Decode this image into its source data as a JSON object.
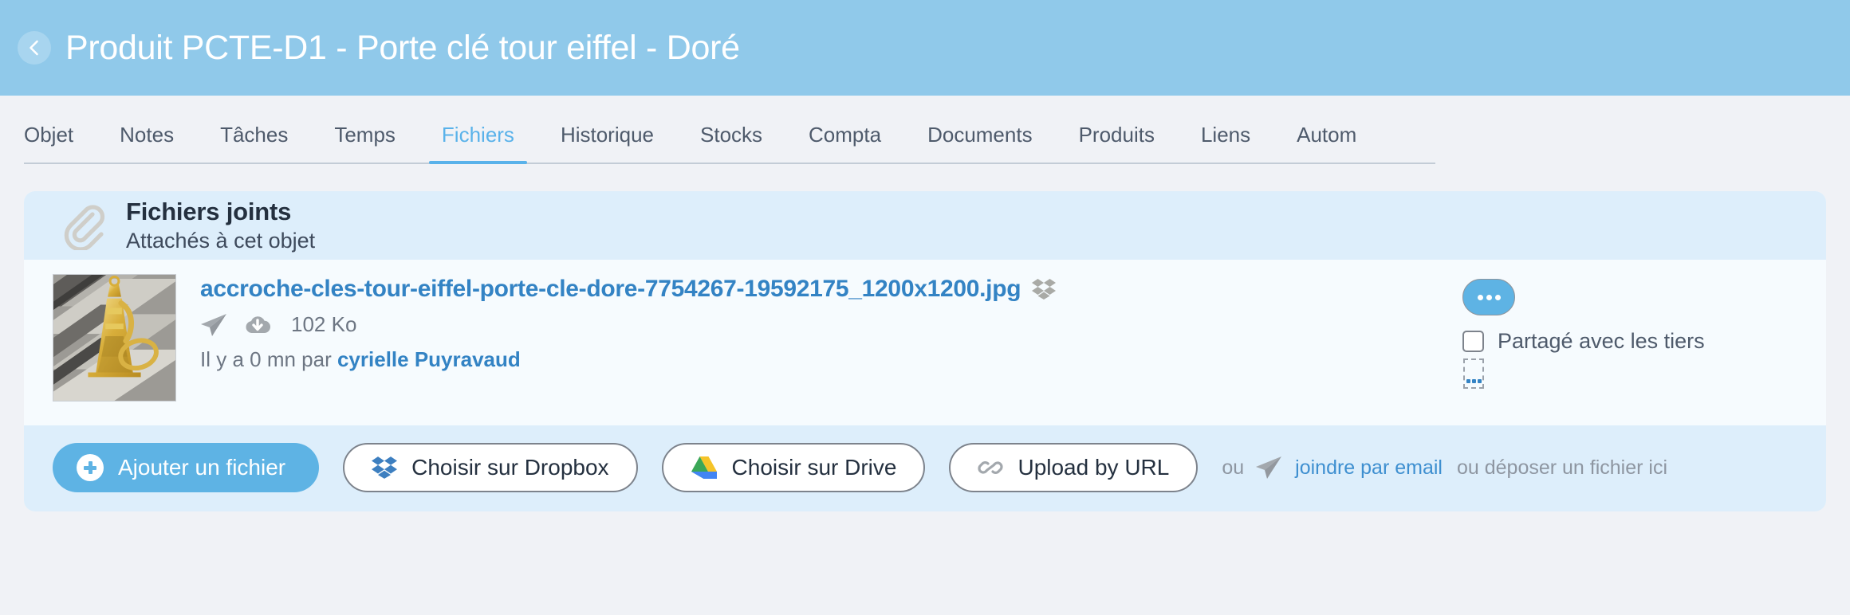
{
  "header": {
    "title": "Produit PCTE-D1 - Porte clé tour eiffel - Doré",
    "back_icon": "chevron-left-icon",
    "background_color": "#90c9ea"
  },
  "tabs": [
    {
      "label": "Objet",
      "active": false
    },
    {
      "label": "Notes",
      "active": false
    },
    {
      "label": "Tâches",
      "active": false
    },
    {
      "label": "Temps",
      "active": false
    },
    {
      "label": "Fichiers",
      "active": true
    },
    {
      "label": "Historique",
      "active": false
    },
    {
      "label": "Stocks",
      "active": false
    },
    {
      "label": "Compta",
      "active": false
    },
    {
      "label": "Documents",
      "active": false
    },
    {
      "label": "Produits",
      "active": false
    },
    {
      "label": "Liens",
      "active": false
    },
    {
      "label": "Autom",
      "active": false
    }
  ],
  "card": {
    "icon": "paperclip-icon",
    "title": "Fichiers joints",
    "subtitle": "Attachés à cet objet",
    "header_color": "#ddeefb"
  },
  "file": {
    "thumbnail_alt": "gold-eiffel-tower-keychain-on-wood",
    "name": "accroche-cles-tour-eiffel-porte-cle-dore-7754267-19592175_1200x1200.jpg",
    "source_icon": "dropbox-icon",
    "send_icon": "paper-plane-icon",
    "download_icon": "cloud-download-icon",
    "size": "102 Ko",
    "meta": "Il y a 0 mn par ",
    "author": "cyrielle Puyravaud",
    "more_label": "...",
    "share_label": "Partagé avec les tiers",
    "share_checked": false,
    "link_color": "#3383c4"
  },
  "footer": {
    "add_file_label": "Ajouter un fichier",
    "add_file_icon": "plus-circle-icon",
    "dropbox_label": "Choisir sur Dropbox",
    "dropbox_icon": "dropbox-icon",
    "drive_label": "Choisir sur Drive",
    "drive_icon": "google-drive-icon",
    "url_label": "Upload by URL",
    "url_icon": "link-chain-icon",
    "tail_or": "ou",
    "tail_plane_icon": "paper-plane-icon",
    "tail_link": "joindre par email",
    "tail_drop": "ou déposer un fichier ici",
    "primary_color": "#5eb3e4"
  }
}
